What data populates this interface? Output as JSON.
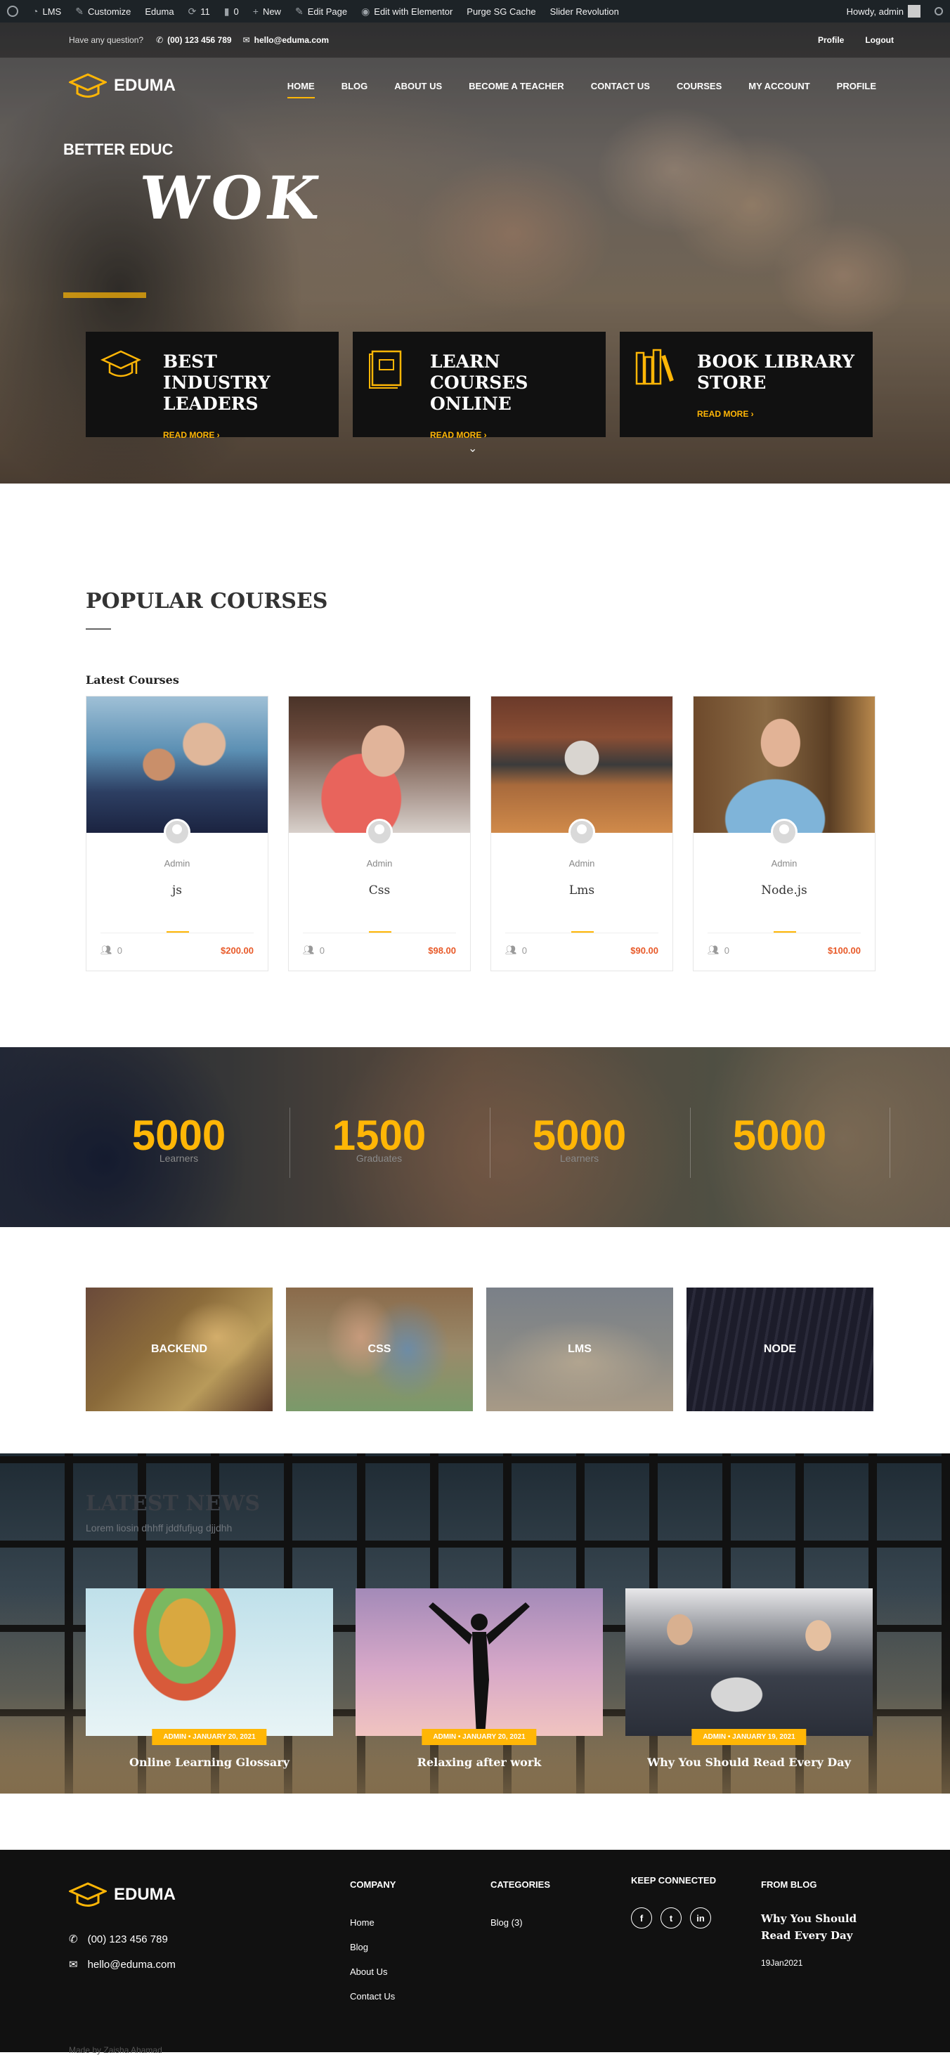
{
  "adminbar": {
    "site": "LMS",
    "customize": "Customize",
    "theme": "Eduma",
    "updates": "11",
    "comments": "0",
    "new": "New",
    "edit_page": "Edit Page",
    "elementor": "Edit with Elementor",
    "purge": "Purge SG Cache",
    "slider": "Slider Revolution",
    "howdy": "Howdy, admin"
  },
  "topinfo": {
    "question": "Have any question?",
    "phone": "(00) 123 456 789",
    "email": "hello@eduma.com",
    "profile": "Profile",
    "logout": "Logout"
  },
  "logo": "EDUMA",
  "menu": [
    "HOME",
    "BLOG",
    "ABOUT US",
    "BECOME A TEACHER",
    "CONTACT US",
    "COURSES",
    "MY ACCOUNT",
    "PROFILE"
  ],
  "hero": {
    "title": "BETTER EDUC",
    "word": "WOK"
  },
  "features": [
    {
      "title": "BEST INDUSTRY LEADERS",
      "more": "READ MORE"
    },
    {
      "title": "LEARN COURSES ONLINE",
      "more": "READ MORE"
    },
    {
      "title": "BOOK LIBRARY STORE",
      "more": "READ MORE"
    }
  ],
  "popular": {
    "title": "POPULAR COURSES",
    "latest": "Latest Courses"
  },
  "courses": [
    {
      "author": "Admin",
      "name": "js",
      "students": "0",
      "price": "$200.00"
    },
    {
      "author": "Admin",
      "name": "Css",
      "students": "0",
      "price": "$98.00"
    },
    {
      "author": "Admin",
      "name": "Lms",
      "students": "0",
      "price": "$90.00"
    },
    {
      "author": "Admin",
      "name": "Node.js",
      "students": "0",
      "price": "$100.00"
    }
  ],
  "stats": [
    {
      "num": "5000",
      "label": "Learners"
    },
    {
      "num": "1500",
      "label": "Graduates"
    },
    {
      "num": "5000",
      "label": "Learners"
    },
    {
      "num": "5000",
      "label": ""
    }
  ],
  "categories": [
    "BACKEND",
    "CSS",
    "LMS",
    "NODE"
  ],
  "news": {
    "title": "LATEST NEWS",
    "subtitle": "Lorem liosin dhhff jddfufjug djjdhh",
    "posts": [
      {
        "meta": "ADMIN • JANUARY 20, 2021",
        "title": "Online Learning Glossary"
      },
      {
        "meta": "ADMIN • JANUARY 20, 2021",
        "title": "Relaxing after work"
      },
      {
        "meta": "ADMIN • JANUARY 19, 2021",
        "title": "Why You Should Read Every Day"
      }
    ]
  },
  "footer": {
    "logo": "EDUMA",
    "phone": "(00) 123 456 789",
    "email": "hello@eduma.com",
    "company_title": "COMPANY",
    "company_links": [
      "Home",
      "Blog",
      "About Us",
      "Contact Us"
    ],
    "categories_title": "CATEGORIES",
    "categories_links": [
      "Blog (3)"
    ],
    "social_title": "KEEP CONNECTED",
    "social": [
      "f",
      "t",
      "in"
    ],
    "blog_title": "FROM BLOG",
    "blog_post": "Why You Should Read Every Day",
    "blog_date": "19Jan2021",
    "made": "Made by Zaisha Ahamad"
  },
  "colors": {
    "accent": "#ffb606",
    "price": "#e85a29",
    "dark": "#111111",
    "adminbar": "#1d2327"
  }
}
